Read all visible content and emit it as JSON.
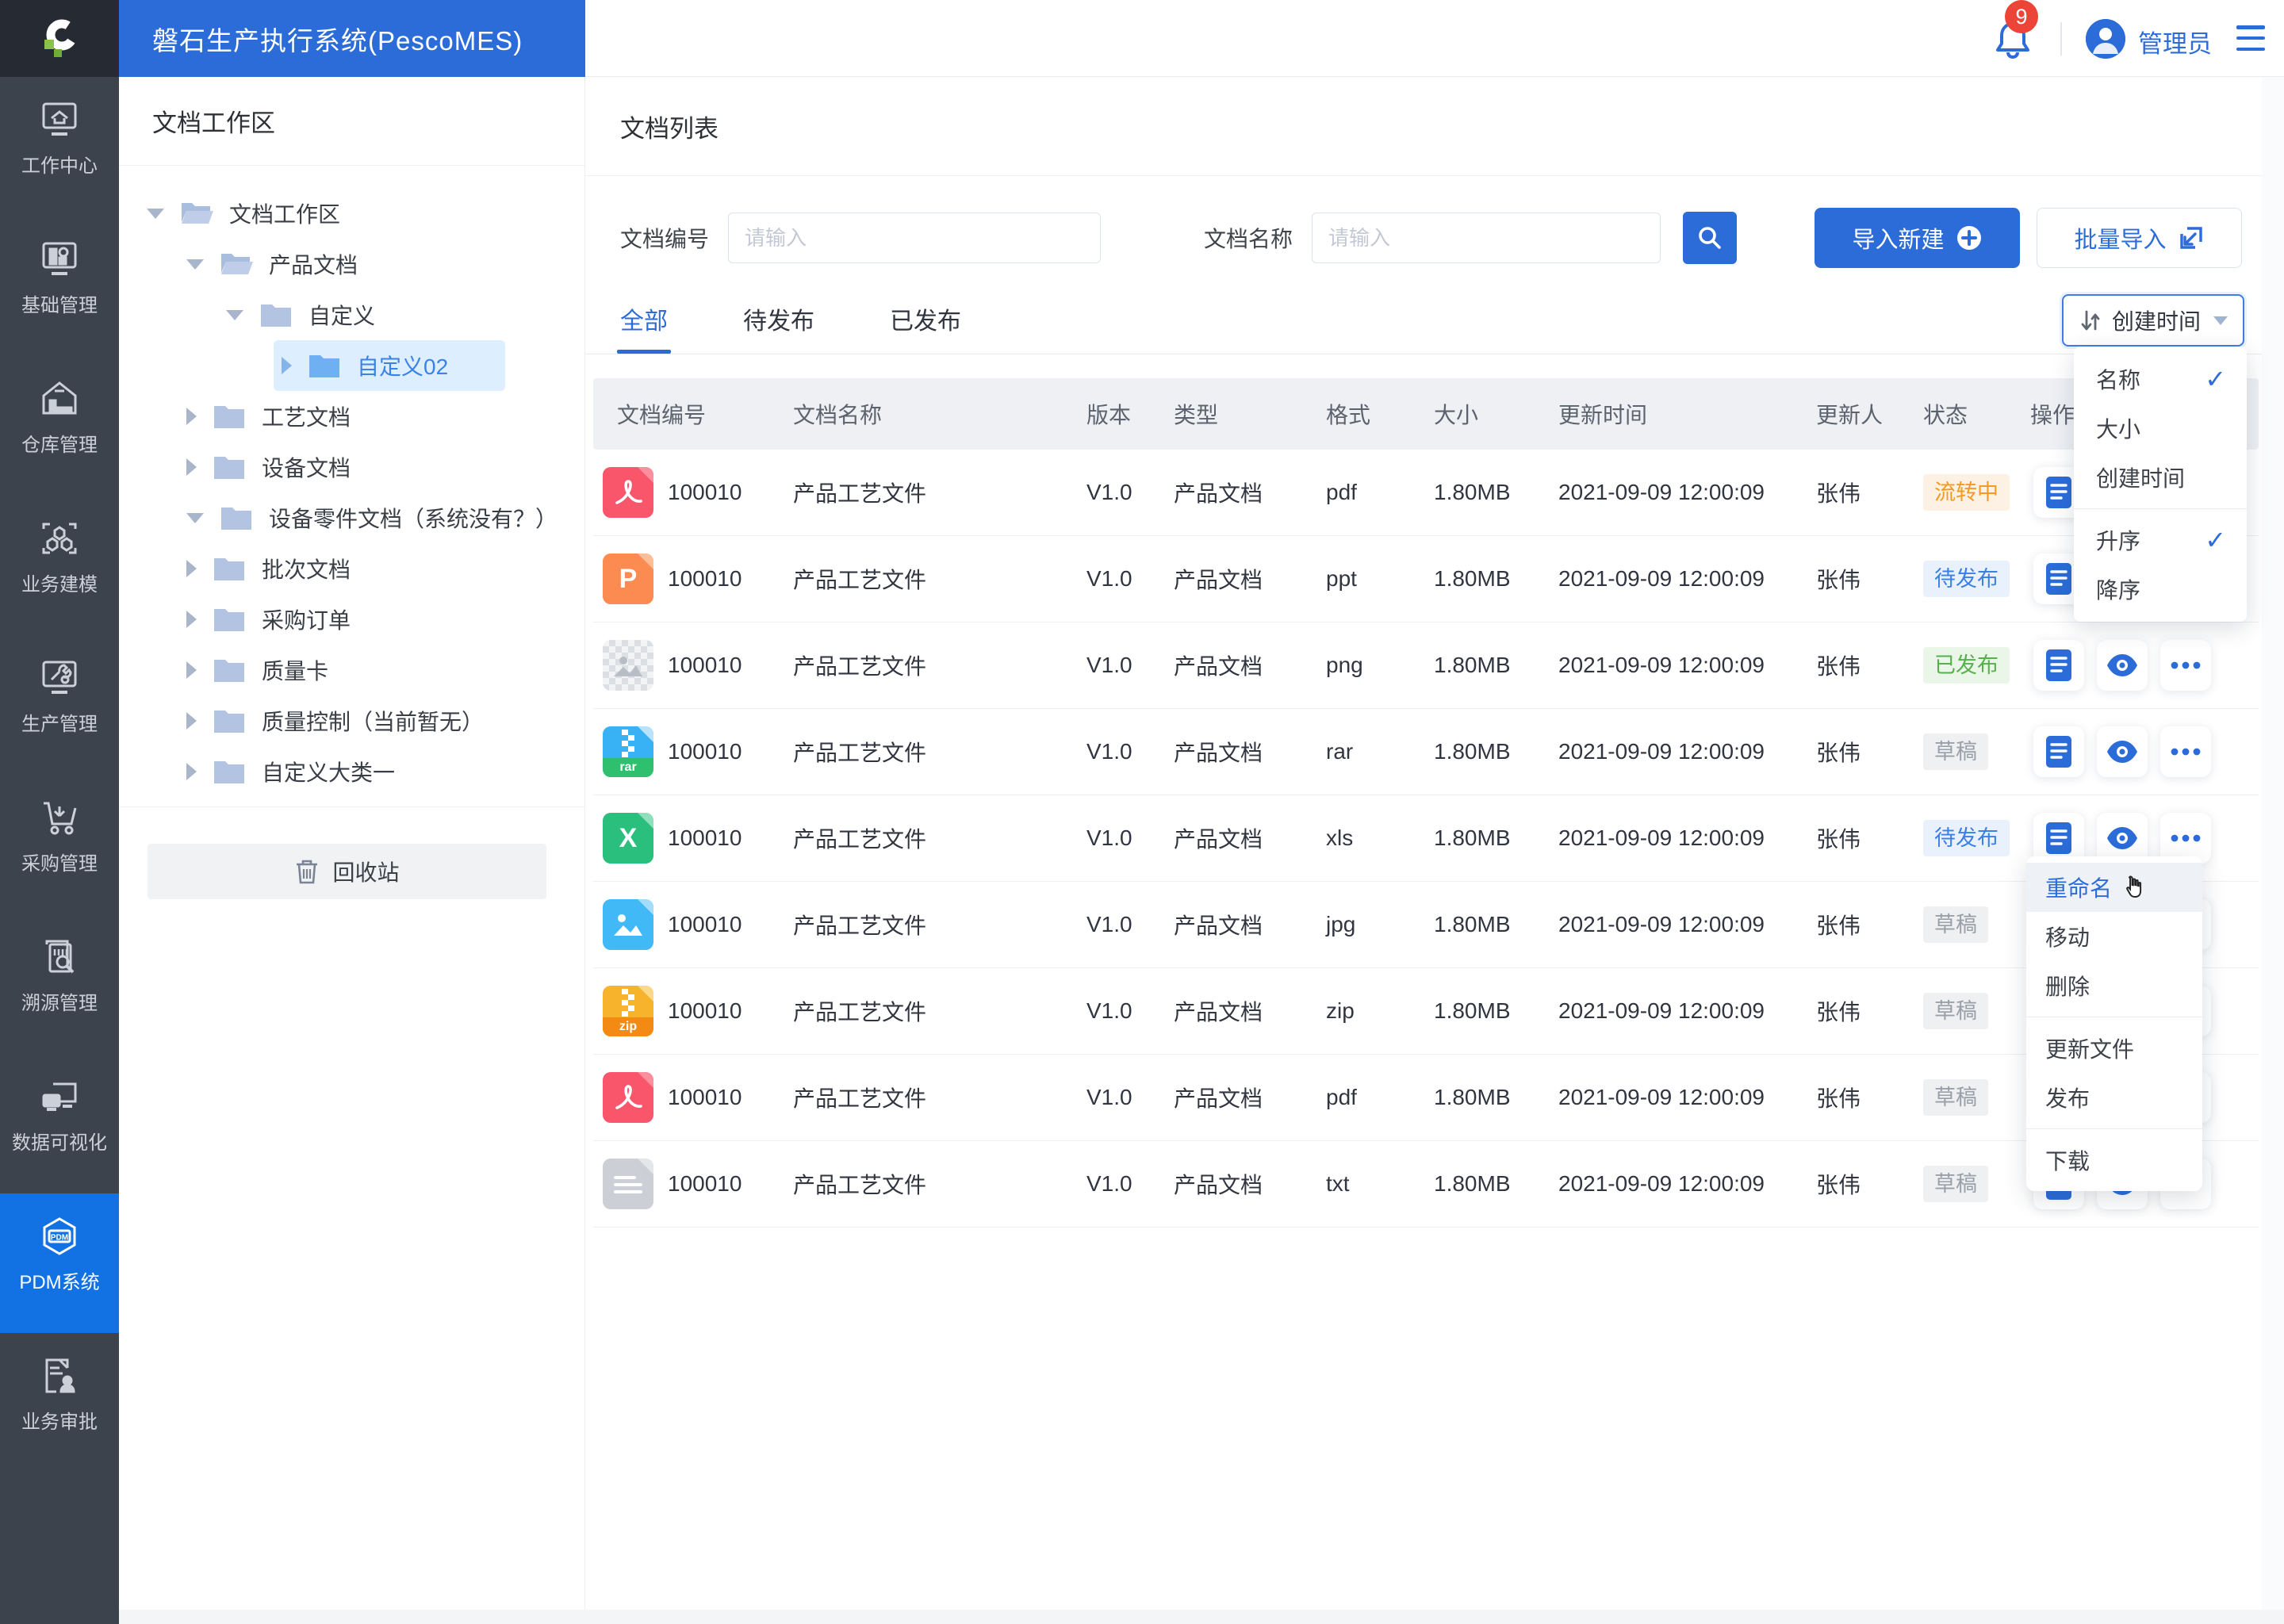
{
  "topbar": {
    "title": "磐石生产执行系统(PescoMES)",
    "notification_count": "9",
    "user_name": "管理员"
  },
  "rail": {
    "items": [
      {
        "label": "工作中心",
        "icon": "workcenter-icon"
      },
      {
        "label": "基础管理",
        "icon": "base-management-icon"
      },
      {
        "label": "仓库管理",
        "icon": "warehouse-icon"
      },
      {
        "label": "业务建模",
        "icon": "business-modeling-icon"
      },
      {
        "label": "生产管理",
        "icon": "production-icon"
      },
      {
        "label": "采购管理",
        "icon": "procurement-icon"
      },
      {
        "label": "溯源管理",
        "icon": "traceability-icon"
      },
      {
        "label": "数据可视化",
        "icon": "data-visualization-icon"
      },
      {
        "label": "PDM系统",
        "icon": "pdm-icon",
        "active": true
      },
      {
        "label": "业务审批",
        "icon": "approval-icon"
      }
    ]
  },
  "tree": {
    "title": "文档工作区",
    "items": [
      {
        "label": "文档工作区",
        "level": 0,
        "state": "expanded"
      },
      {
        "label": "产品文档",
        "level": 1,
        "state": "expanded"
      },
      {
        "label": "自定义",
        "level": 2,
        "state": "expanded"
      },
      {
        "label": "自定义02",
        "level": 3,
        "state": "collapsed",
        "selected": true
      },
      {
        "label": "工艺文档",
        "level": 1,
        "state": "collapsed"
      },
      {
        "label": "设备文档",
        "level": 1,
        "state": "collapsed"
      },
      {
        "label": "设备零件文档（系统没有？）",
        "level": 1,
        "state": "expanded"
      },
      {
        "label": "批次文档",
        "level": 1,
        "state": "collapsed"
      },
      {
        "label": "采购订单",
        "level": 1,
        "state": "collapsed"
      },
      {
        "label": "质量卡",
        "level": 1,
        "state": "collapsed"
      },
      {
        "label": "质量控制（当前暂无）",
        "level": 1,
        "state": "collapsed"
      },
      {
        "label": "自定义大类一",
        "level": 1,
        "state": "collapsed"
      }
    ],
    "recycle_label": "回收站"
  },
  "main": {
    "title": "文档列表",
    "search": {
      "code_label": "文档编号",
      "code_placeholder": "请输入",
      "name_label": "文档名称",
      "name_placeholder": "请输入"
    },
    "buttons": {
      "import_new": "导入新建",
      "batch_import": "批量导入"
    },
    "tabs": [
      {
        "label": "全部",
        "active": true
      },
      {
        "label": "待发布",
        "active": false
      },
      {
        "label": "已发布",
        "active": false
      }
    ],
    "sort_button_label": "创建时间",
    "table": {
      "columns": {
        "code": "文档编号",
        "name": "文档名称",
        "version": "版本",
        "type": "类型",
        "format": "格式",
        "size": "大小",
        "updated": "更新时间",
        "updater": "更新人",
        "status": "状态",
        "actions": "操作"
      },
      "rows": [
        {
          "file_type": "pdf",
          "code": "100010",
          "name": "产品工艺文件",
          "version": "V1.0",
          "type": "产品文档",
          "format": "pdf",
          "size": "1.80MB",
          "updated": "2021-09-09 12:00:09",
          "updater": "张伟",
          "status": "流转中"
        },
        {
          "file_type": "ppt",
          "code": "100010",
          "name": "产品工艺文件",
          "version": "V1.0",
          "type": "产品文档",
          "format": "ppt",
          "size": "1.80MB",
          "updated": "2021-09-09 12:00:09",
          "updater": "张伟",
          "status": "待发布"
        },
        {
          "file_type": "png",
          "code": "100010",
          "name": "产品工艺文件",
          "version": "V1.0",
          "type": "产品文档",
          "format": "png",
          "size": "1.80MB",
          "updated": "2021-09-09 12:00:09",
          "updater": "张伟",
          "status": "已发布"
        },
        {
          "file_type": "rar",
          "code": "100010",
          "name": "产品工艺文件",
          "version": "V1.0",
          "type": "产品文档",
          "format": "rar",
          "size": "1.80MB",
          "updated": "2021-09-09 12:00:09",
          "updater": "张伟",
          "status": "草稿"
        },
        {
          "file_type": "xls",
          "code": "100010",
          "name": "产品工艺文件",
          "version": "V1.0",
          "type": "产品文档",
          "format": "xls",
          "size": "1.80MB",
          "updated": "2021-09-09 12:00:09",
          "updater": "张伟",
          "status": "待发布"
        },
        {
          "file_type": "jpg",
          "code": "100010",
          "name": "产品工艺文件",
          "version": "V1.0",
          "type": "产品文档",
          "format": "jpg",
          "size": "1.80MB",
          "updated": "2021-09-09 12:00:09",
          "updater": "张伟",
          "status": "草稿"
        },
        {
          "file_type": "zip",
          "code": "100010",
          "name": "产品工艺文件",
          "version": "V1.0",
          "type": "产品文档",
          "format": "zip",
          "size": "1.80MB",
          "updated": "2021-09-09 12:00:09",
          "updater": "张伟",
          "status": "草稿"
        },
        {
          "file_type": "pdf",
          "code": "100010",
          "name": "产品工艺文件",
          "version": "V1.0",
          "type": "产品文档",
          "format": "pdf",
          "size": "1.80MB",
          "updated": "2021-09-09 12:00:09",
          "updater": "张伟",
          "status": "草稿"
        },
        {
          "file_type": "txt",
          "code": "100010",
          "name": "产品工艺文件",
          "version": "V1.0",
          "type": "产品文档",
          "format": "txt",
          "size": "1.80MB",
          "updated": "2021-09-09 12:00:09",
          "updater": "张伟",
          "status": "草稿"
        }
      ]
    }
  },
  "sort_menu": {
    "fields": [
      {
        "label": "名称",
        "checked": true
      },
      {
        "label": "大小",
        "checked": false
      },
      {
        "label": "创建时间",
        "checked": false
      }
    ],
    "orders": [
      {
        "label": "升序",
        "checked": true
      },
      {
        "label": "降序",
        "checked": false
      }
    ]
  },
  "context_menu": {
    "items": [
      {
        "label": "重命名",
        "active": true
      },
      {
        "label": "移动"
      },
      {
        "label": "删除"
      },
      {
        "label": "更新文件"
      },
      {
        "label": "发布"
      },
      {
        "label": "下载"
      }
    ]
  },
  "colors": {
    "primary_blue": "#2b6cd9",
    "rail_active_blue": "#1272e4",
    "badge_processing": "#f59a23",
    "badge_pending": "#3b7fe8",
    "badge_published": "#56b04c",
    "badge_draft": "#9aa0aa",
    "notification_red": "#ec4537"
  }
}
